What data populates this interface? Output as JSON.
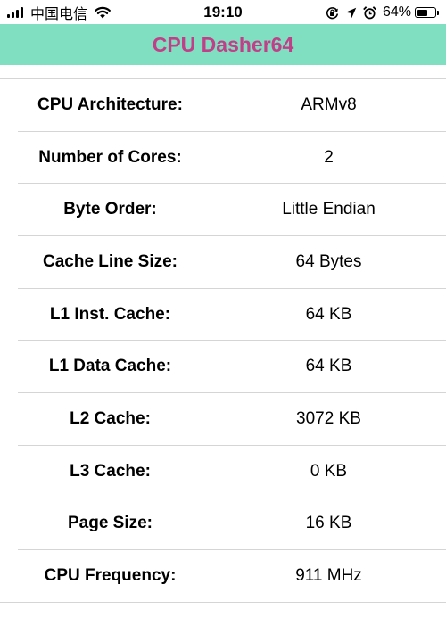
{
  "status_bar": {
    "carrier": "中国电信",
    "time": "19:10",
    "battery_percent": "64%",
    "battery_level": 0.64,
    "icons": [
      "signal-icon",
      "wifi-icon",
      "orientation-lock-icon",
      "location-icon",
      "alarm-icon",
      "battery-icon"
    ]
  },
  "nav": {
    "title": "CPU Dasher64",
    "background_color": "#80dfc0",
    "title_color": "#c13f89"
  },
  "rows": [
    {
      "label": "CPU Architecture:",
      "value": "ARMv8"
    },
    {
      "label": "Number of Cores:",
      "value": "2"
    },
    {
      "label": "Byte Order:",
      "value": "Little Endian"
    },
    {
      "label": "Cache Line Size:",
      "value": "64 Bytes"
    },
    {
      "label": "L1 Inst. Cache:",
      "value": "64 KB"
    },
    {
      "label": "L1 Data Cache:",
      "value": "64 KB"
    },
    {
      "label": "L2 Cache:",
      "value": "3072 KB"
    },
    {
      "label": "L3 Cache:",
      "value": "0 KB"
    },
    {
      "label": "Page Size:",
      "value": "16 KB"
    },
    {
      "label": "CPU Frequency:",
      "value": "911 MHz"
    }
  ]
}
